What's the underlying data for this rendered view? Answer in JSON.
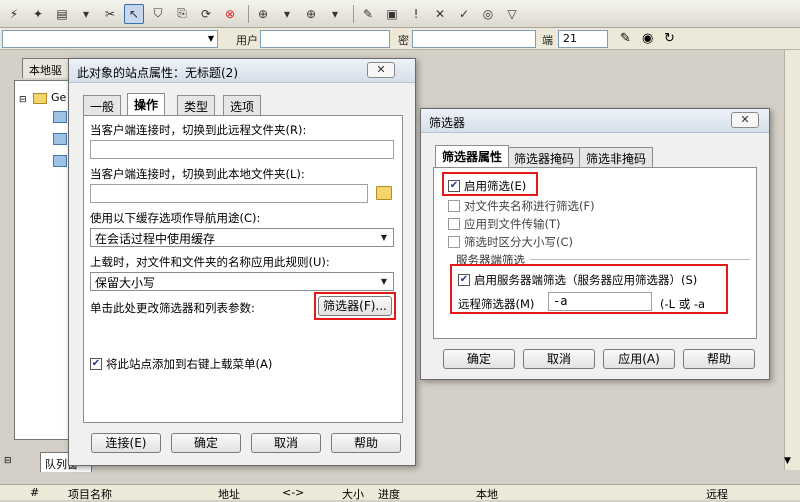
{
  "connbar": {
    "host_value": "",
    "user_label": "用户",
    "pass_label": "密",
    "port_label": "端",
    "port_value": "21"
  },
  "left_panel": {
    "tab_label": "本地驱",
    "tree_item": "Ge"
  },
  "queue": {
    "tab_label": "队列窗",
    "columns": [
      "#",
      "项目名称",
      "地址",
      "<->",
      "大小",
      "进度",
      "本地",
      "远程"
    ]
  },
  "site_dialog": {
    "title": "此对象的站点属性：无标题(2)",
    "close_label": "✕",
    "tabs": [
      "一般",
      "操作",
      "类型",
      "选项"
    ],
    "remote_folder_label": "当客户端连接时，切换到此远程文件夹(R):",
    "remote_folder_value": "",
    "local_folder_label": "当客户端连接时，切换到此本地文件夹(L):",
    "local_folder_value": "",
    "cache_label": "使用以下缓存选项作导航用途(C):",
    "cache_value": "在会话过程中使用缓存",
    "upload_rule_label": "上载时，对文件和文件夹的名称应用此规则(U):",
    "upload_rule_value": "保留大小写",
    "filter_hint": "单击此处更改筛选器和列表参数:",
    "filter_button": "筛选器(F)...",
    "add_menu_label": "将此站点添加到右键上载菜单(A)",
    "add_menu_checked": true,
    "buttons": {
      "connect": "连接(E)",
      "ok": "确定",
      "cancel": "取消",
      "help": "帮助"
    }
  },
  "filter_dialog": {
    "title": "筛选器",
    "close_label": "✕",
    "tabs": [
      "筛选器属性",
      "筛选器掩码",
      "筛选非掩码"
    ],
    "enable_filter": {
      "label": "启用筛选(E)",
      "checked": true
    },
    "opt_folder_names": "对文件夹名称进行筛选(F)",
    "opt_apply_transfer": "应用到文件传输(T)",
    "opt_case_sensitive": "筛选时区分大小写(C)",
    "server_group_label": "服务器端筛选",
    "server_filter": {
      "label": "启用服务器端筛选（服务器应用筛选器）(S)",
      "checked": true
    },
    "remote_filter_label": "远程筛选器(M)",
    "remote_filter_value": "-a",
    "remote_filter_hint": "(-L 或 -a",
    "buttons": {
      "ok": "确定",
      "cancel": "取消",
      "apply": "应用(A)",
      "help": "帮助"
    }
  },
  "colors": {
    "highlight_red": "#e3191a",
    "check_blue": "#1f3c88"
  }
}
